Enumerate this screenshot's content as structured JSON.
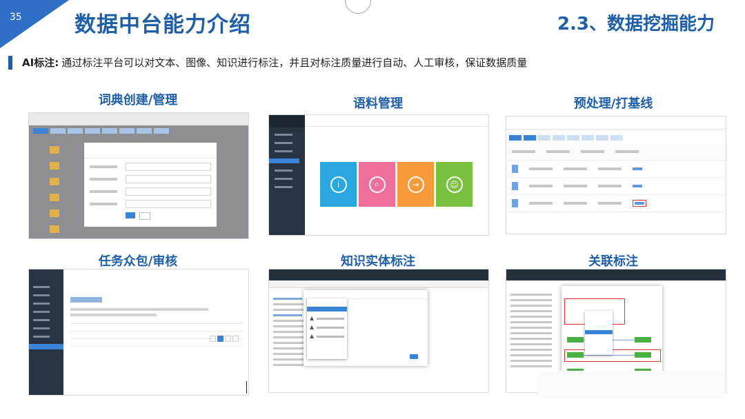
{
  "slide": {
    "page_number": "35",
    "title": "数据中台能力介绍",
    "section": "2.3、数据挖掘能力"
  },
  "intro": {
    "label": "AI标注:",
    "text": "通过标注平台可以对文本、图像、知识进行标注，并且对标注质量进行自动、人工审核，保证数据质量"
  },
  "panels": [
    {
      "caption": "词典创建/管理"
    },
    {
      "caption": "语料管理"
    },
    {
      "caption": "预处理/打基线"
    },
    {
      "caption": "任务众包/审核"
    },
    {
      "caption": "知识实体标注"
    },
    {
      "caption": "关联标注"
    }
  ],
  "colors": {
    "accent": "#1f5fa8",
    "corner": "#2f6fc4",
    "tile_blue": "#29a8e0",
    "tile_pink": "#ee6f9b",
    "tile_orange": "#f59a3a",
    "tile_green": "#7ac142"
  }
}
